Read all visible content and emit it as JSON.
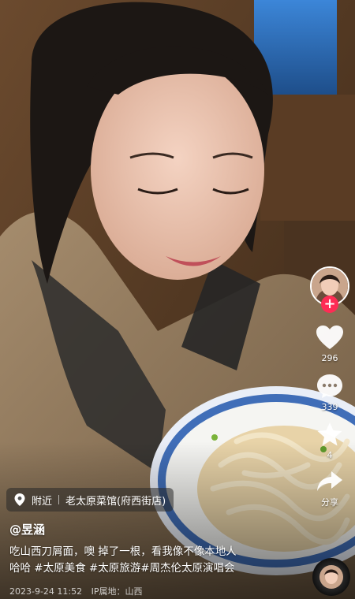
{
  "location": {
    "icon": "location-pin-icon",
    "nearby_label": "附近",
    "place_name": "老太原菜馆(府西街店)"
  },
  "author": {
    "handle": "@昱涵"
  },
  "caption": {
    "line1": "吃山西刀屑面，噢 掉了一根，看我像不像本地人",
    "line2": "哈哈 #太原美食 #太原旅游#周杰伦太原演唱会"
  },
  "meta": {
    "date": "2023-9-24 11:52",
    "ip_location": "IP属地：山西"
  },
  "actions": {
    "follow_label": "+",
    "like_count": "296",
    "comment_count": "339",
    "favorite_count": "4",
    "share_label": "分享"
  },
  "colors": {
    "follow_accent": "#fe2c55",
    "overlay_text": "#ffffff"
  }
}
